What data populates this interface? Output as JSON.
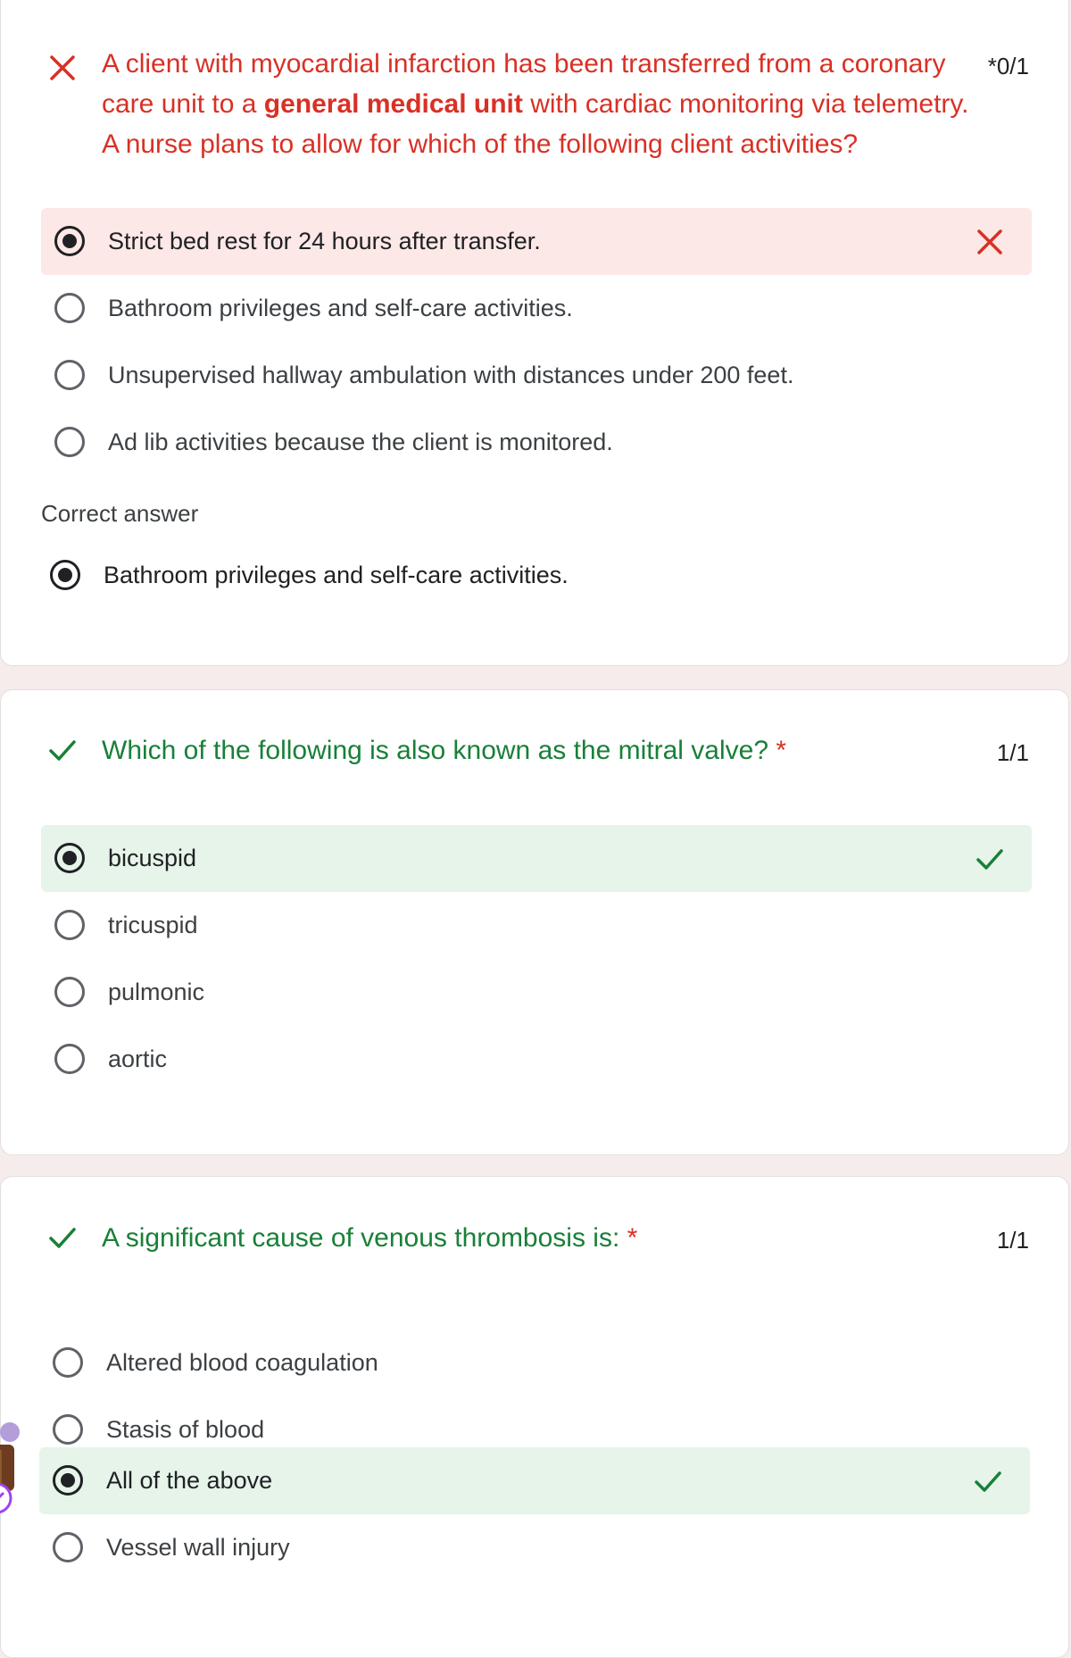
{
  "questions": [
    {
      "status": "incorrect",
      "text_before": "A client with myocardial infarction has been transferred from a coronary care unit to a ",
      "text_bold": "general medical unit",
      "text_after": " with cardiac monitoring via telemetry. A nurse plans to allow for which of the following client activities?",
      "required": "*",
      "score": "0/1",
      "options": [
        "Strict bed rest for 24 hours after transfer.",
        "Bathroom privileges and self-care activities.",
        "Unsupervised hallway ambulation with distances under 200 feet.",
        "Ad lib activities because the client is monitored."
      ],
      "selected_index": 0,
      "correct_answer_label": "Correct answer",
      "correct_answer": "Bathroom privileges and self-care activities."
    },
    {
      "status": "correct",
      "text": "Which of the following is also known as the mitral valve?",
      "required": "*",
      "score": "1/1",
      "options": [
        "bicuspid",
        "tricuspid",
        "pulmonic",
        "aortic"
      ],
      "selected_index": 0
    },
    {
      "status": "correct",
      "text": "A significant cause of venous thrombosis is:",
      "required": "*",
      "score": "1/1",
      "options": [
        "Altered blood coagulation",
        "Stasis of blood",
        "All of the above",
        "Vessel wall injury"
      ],
      "selected_index": 2
    }
  ],
  "colors": {
    "incorrect": "#d93025",
    "correct": "#188038",
    "wrong_bg": "#fce8e6",
    "right_bg": "#e6f4ea",
    "page_bg": "#f6ecec"
  }
}
